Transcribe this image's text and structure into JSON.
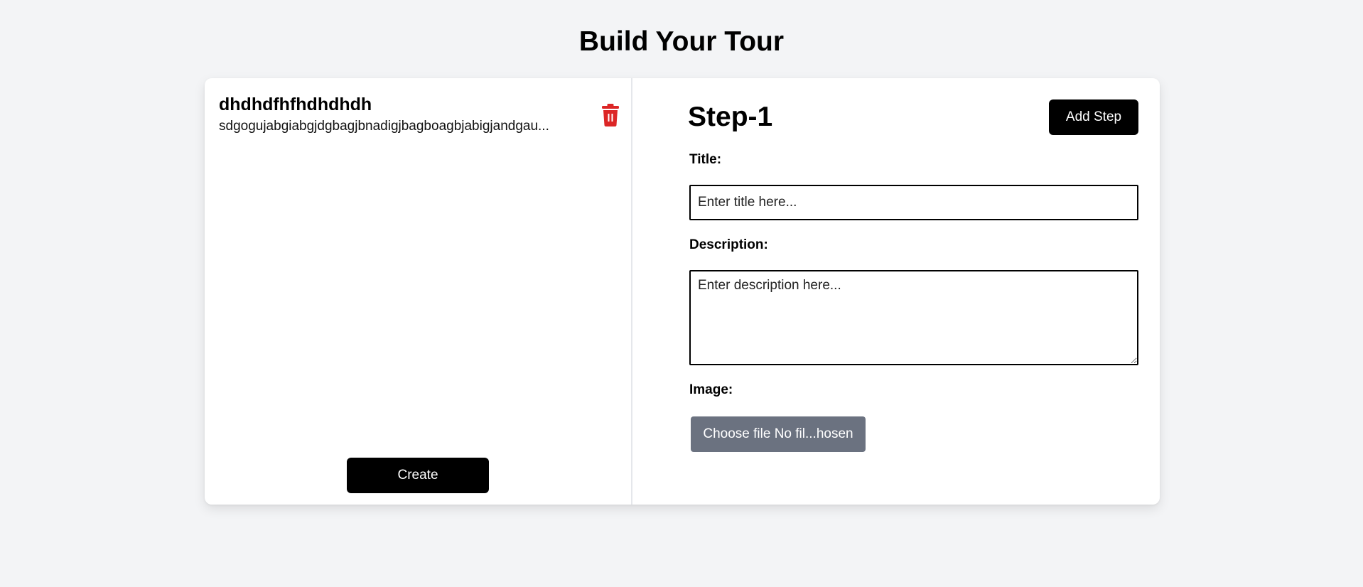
{
  "page": {
    "title": "Build Your Tour"
  },
  "steps_list": {
    "items": [
      {
        "title": "dhdhdfhfhdhdhdh",
        "description": "sdgogujabgiabgjdgbagjbnadigjbagboagbjabigjandgau..."
      }
    ],
    "delete_icon": "trash-icon",
    "create_label": "Create"
  },
  "editor": {
    "step_heading": "Step-1",
    "add_step_label": "Add Step",
    "title_label": "Title:",
    "title_placeholder": "Enter title here...",
    "description_label": "Description:",
    "description_placeholder": "Enter description here...",
    "image_label": "Image:",
    "file_button_text": "Choose file No fil...hosen"
  },
  "colors": {
    "background": "#f3f4f6",
    "primary_button": "#000000",
    "delete_icon": "#dc2626",
    "file_button": "#6b7280"
  }
}
